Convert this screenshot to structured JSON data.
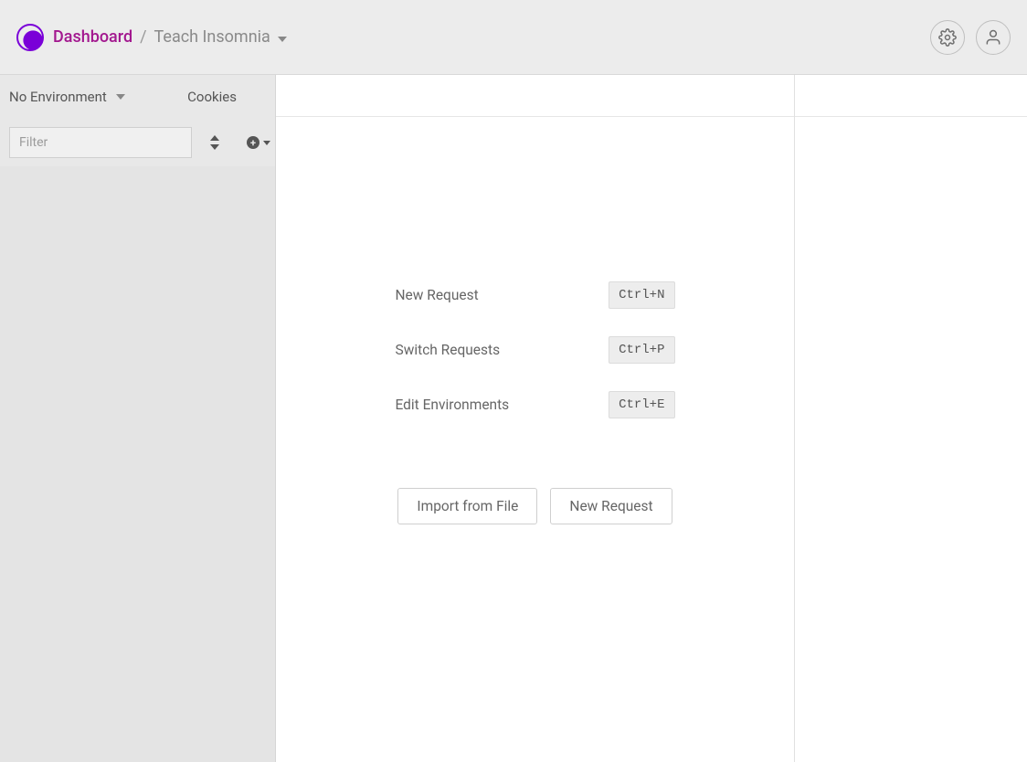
{
  "header": {
    "dashboard_label": "Dashboard",
    "separator": "/",
    "project_name": "Teach Insomnia"
  },
  "sidebar": {
    "environment_label": "No Environment",
    "cookies_label": "Cookies",
    "filter_placeholder": "Filter"
  },
  "main": {
    "shortcuts": [
      {
        "label": "New Request",
        "key": "Ctrl+N"
      },
      {
        "label": "Switch Requests",
        "key": "Ctrl+P"
      },
      {
        "label": "Edit Environments",
        "key": "Ctrl+E"
      }
    ],
    "import_button": "Import from File",
    "new_request_button": "New Request"
  }
}
